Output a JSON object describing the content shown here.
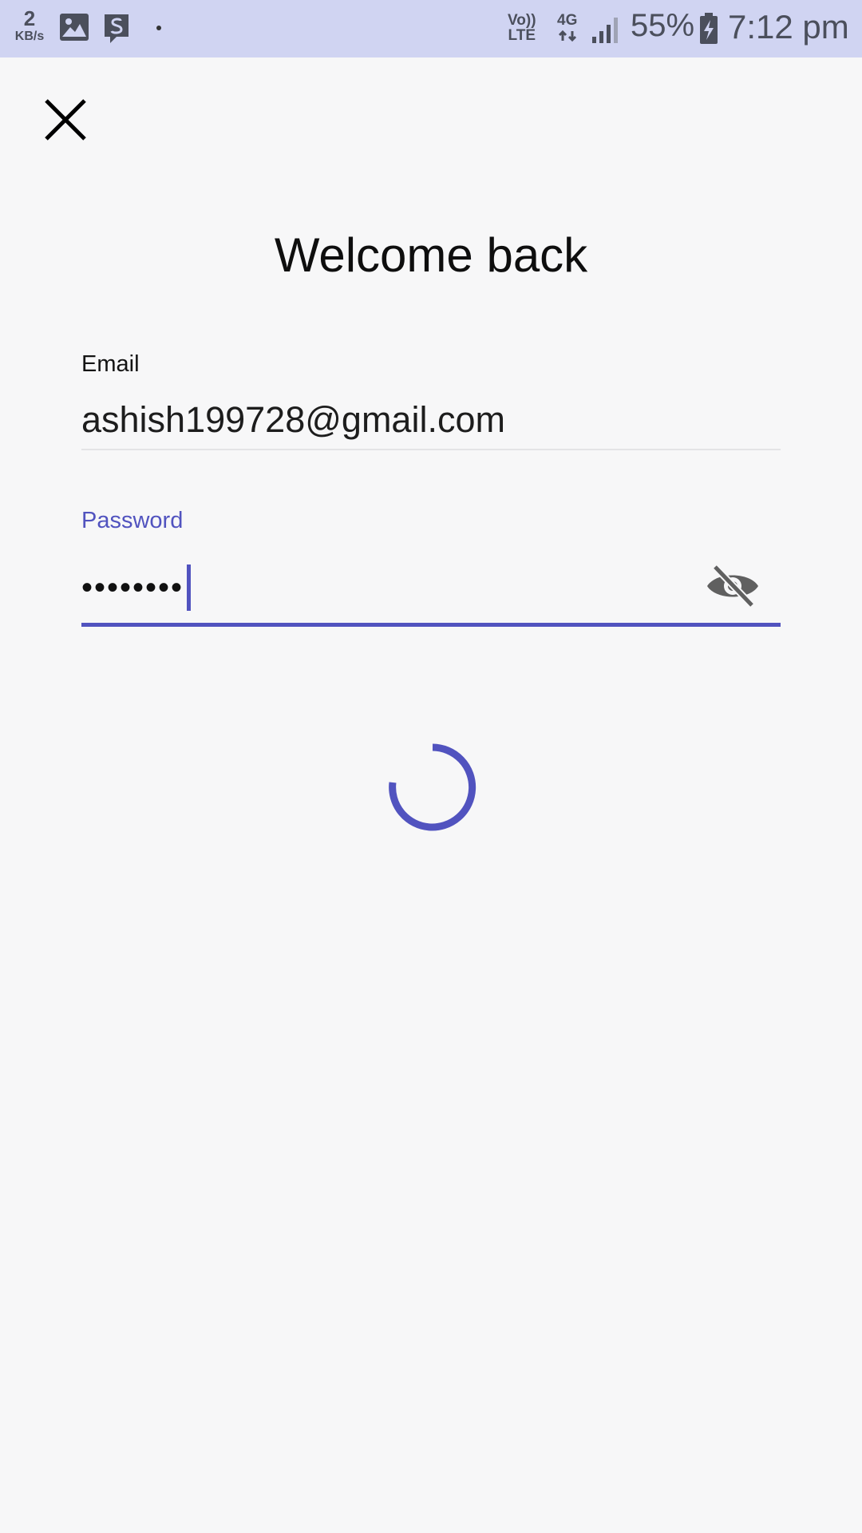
{
  "status_bar": {
    "net_speed_value": "2",
    "net_speed_unit": "KB/s",
    "volte_top": "Vo))",
    "volte_bottom": "LTE",
    "network_type": "4G",
    "battery_percent": "55%",
    "time": "7:12 pm",
    "icons": [
      "gallery-icon",
      "s-app-icon",
      "dot-icon",
      "signal-icon",
      "battery-charging-icon"
    ]
  },
  "screen": {
    "title": "Welcome back",
    "email": {
      "label": "Email",
      "value": "ashish199728@gmail.com"
    },
    "password": {
      "label": "Password",
      "masked_value": "••••••••"
    },
    "accent_color": "#5153bf",
    "close_icon": "close-icon",
    "visibility_icon": "visibility-off-icon",
    "loading": true
  }
}
